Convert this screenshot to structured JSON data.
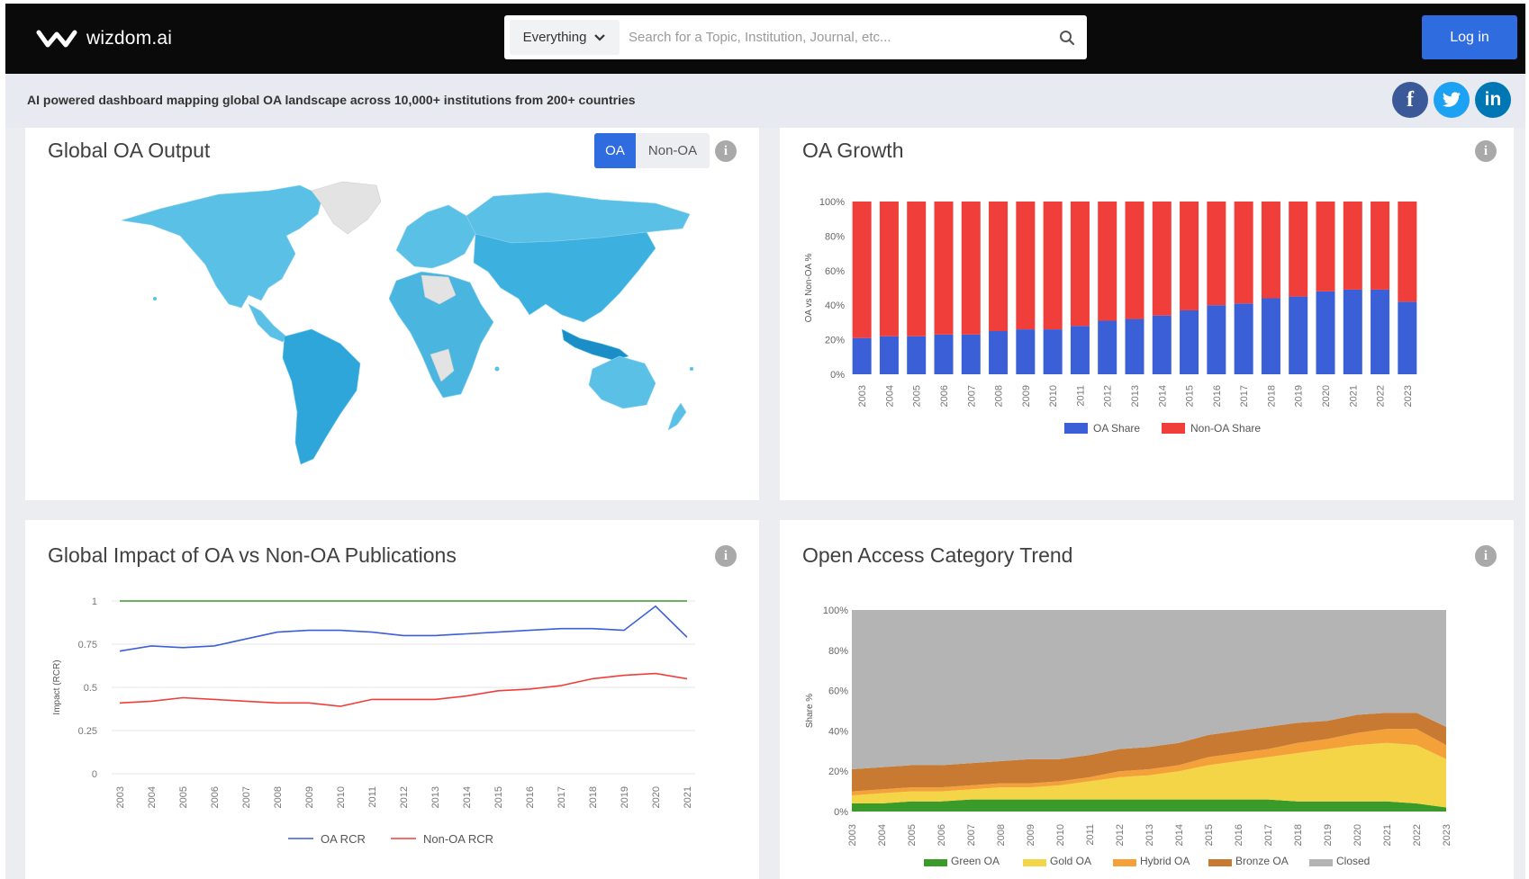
{
  "brand": {
    "name": "wizdom.ai"
  },
  "search": {
    "scope": "Everything",
    "placeholder": "Search for a Topic, Institution, Journal, etc..."
  },
  "header": {
    "login_label": "Log in"
  },
  "subbar": {
    "tagline": "AI powered dashboard mapping global OA landscape across 10,000+ institutions from 200+ countries",
    "social": {
      "facebook": "f",
      "linkedin": "in"
    }
  },
  "cards": {
    "global_output": {
      "title": "Global OA Output",
      "toggle": [
        "OA",
        "Non-OA"
      ],
      "selected": "OA",
      "info": "i"
    },
    "oa_growth": {
      "title": "OA Growth",
      "info": "i"
    },
    "impact": {
      "title": "Global Impact of OA vs Non-OA Publications",
      "info": "i"
    },
    "category_trend": {
      "title": "Open Access Category Trend",
      "info": "i"
    }
  },
  "colors": {
    "accent": "#2f6ce0",
    "oa_share": "#3b5fd6",
    "non_oa_share": "#f03e3a",
    "map_fill": "#5bc0e6",
    "map_dark": "#2a9fd8",
    "map_none": "#e3e3e3",
    "green_oa": "#3a9a2a",
    "gold_oa": "#f5d548",
    "hybrid_oa": "#f4a13a",
    "bronze_oa": "#c87a33",
    "closed": "#b4b4b4"
  },
  "chart_data": [
    {
      "id": "oa_growth",
      "type": "bar",
      "stacked": true,
      "categories": [
        "2003",
        "2004",
        "2005",
        "2006",
        "2007",
        "2008",
        "2009",
        "2010",
        "2011",
        "2012",
        "2013",
        "2014",
        "2015",
        "2016",
        "2017",
        "2018",
        "2019",
        "2020",
        "2021",
        "2022",
        "2023"
      ],
      "series": [
        {
          "name": "OA Share",
          "values": [
            21,
            22,
            22,
            23,
            23,
            25,
            26,
            26,
            28,
            31,
            32,
            34,
            37,
            40,
            41,
            44,
            45,
            48,
            49,
            49,
            42
          ]
        },
        {
          "name": "Non-OA Share",
          "values": [
            79,
            78,
            78,
            77,
            77,
            75,
            74,
            74,
            72,
            69,
            68,
            66,
            63,
            60,
            59,
            56,
            55,
            52,
            51,
            51,
            58
          ]
        }
      ],
      "ylabel": "OA vs Non-OA %",
      "yticks": [
        "0%",
        "20%",
        "40%",
        "60%",
        "80%",
        "100%"
      ],
      "ylim": [
        0,
        100
      ],
      "legend": "bottom",
      "grid": false
    },
    {
      "id": "impact",
      "type": "line",
      "x": [
        "2003",
        "2004",
        "2005",
        "2006",
        "2007",
        "2008",
        "2009",
        "2010",
        "2011",
        "2012",
        "2013",
        "2014",
        "2015",
        "2016",
        "2017",
        "2018",
        "2019",
        "2020",
        "2021"
      ],
      "series": [
        {
          "name": "OA RCR",
          "values": [
            0.71,
            0.74,
            0.73,
            0.74,
            0.78,
            0.82,
            0.83,
            0.83,
            0.82,
            0.8,
            0.8,
            0.81,
            0.82,
            0.83,
            0.84,
            0.84,
            0.83,
            0.97,
            0.79
          ]
        },
        {
          "name": "Non-OA RCR",
          "values": [
            0.41,
            0.42,
            0.44,
            0.43,
            0.42,
            0.41,
            0.41,
            0.39,
            0.43,
            0.43,
            0.43,
            0.45,
            0.48,
            0.49,
            0.51,
            0.55,
            0.57,
            0.58,
            0.55
          ]
        },
        {
          "name": "",
          "values": [
            1,
            1,
            1,
            1,
            1,
            1,
            1,
            1,
            1,
            1,
            1,
            1,
            1,
            1,
            1,
            1,
            1,
            1,
            1
          ]
        }
      ],
      "ylabel": "Impact (RCR)",
      "yticks": [
        "0",
        "0.25",
        "0.5",
        "0.75",
        "1"
      ],
      "ylim": [
        0,
        1
      ],
      "legend": "bottom",
      "grid": true
    },
    {
      "id": "category_trend",
      "type": "area",
      "stacked": true,
      "x": [
        "2003",
        "2004",
        "2005",
        "2006",
        "2007",
        "2008",
        "2009",
        "2010",
        "2011",
        "2012",
        "2013",
        "2014",
        "2015",
        "2016",
        "2017",
        "2018",
        "2019",
        "2020",
        "2021",
        "2022",
        "2023"
      ],
      "series": [
        {
          "name": "Green OA",
          "values": [
            4,
            4,
            5,
            5,
            6,
            6,
            6,
            6,
            6,
            6,
            6,
            6,
            6,
            6,
            6,
            5,
            5,
            5,
            5,
            4,
            2
          ]
        },
        {
          "name": "Gold OA",
          "values": [
            4,
            5,
            5,
            5,
            5,
            6,
            6,
            7,
            9,
            11,
            12,
            14,
            17,
            19,
            21,
            24,
            26,
            28,
            29,
            29,
            24
          ]
        },
        {
          "name": "Hybrid OA",
          "values": [
            2,
            2,
            2,
            2,
            2,
            2,
            2,
            2,
            2,
            3,
            3,
            3,
            4,
            4,
            4,
            5,
            5,
            6,
            7,
            8,
            7
          ]
        },
        {
          "name": "Bronze OA",
          "values": [
            11,
            11,
            11,
            11,
            11,
            11,
            12,
            11,
            11,
            11,
            11,
            11,
            11,
            11,
            11,
            10,
            9,
            9,
            8,
            8,
            9
          ]
        },
        {
          "name": "Closed",
          "values": [
            79,
            78,
            77,
            77,
            76,
            75,
            74,
            74,
            72,
            69,
            68,
            66,
            62,
            60,
            58,
            56,
            55,
            52,
            51,
            51,
            58
          ]
        }
      ],
      "ylabel": "Share %",
      "yticks": [
        "0%",
        "20%",
        "40%",
        "60%",
        "80%",
        "100%"
      ],
      "ylim": [
        0,
        100
      ],
      "legend": "bottom",
      "grid": false
    }
  ]
}
